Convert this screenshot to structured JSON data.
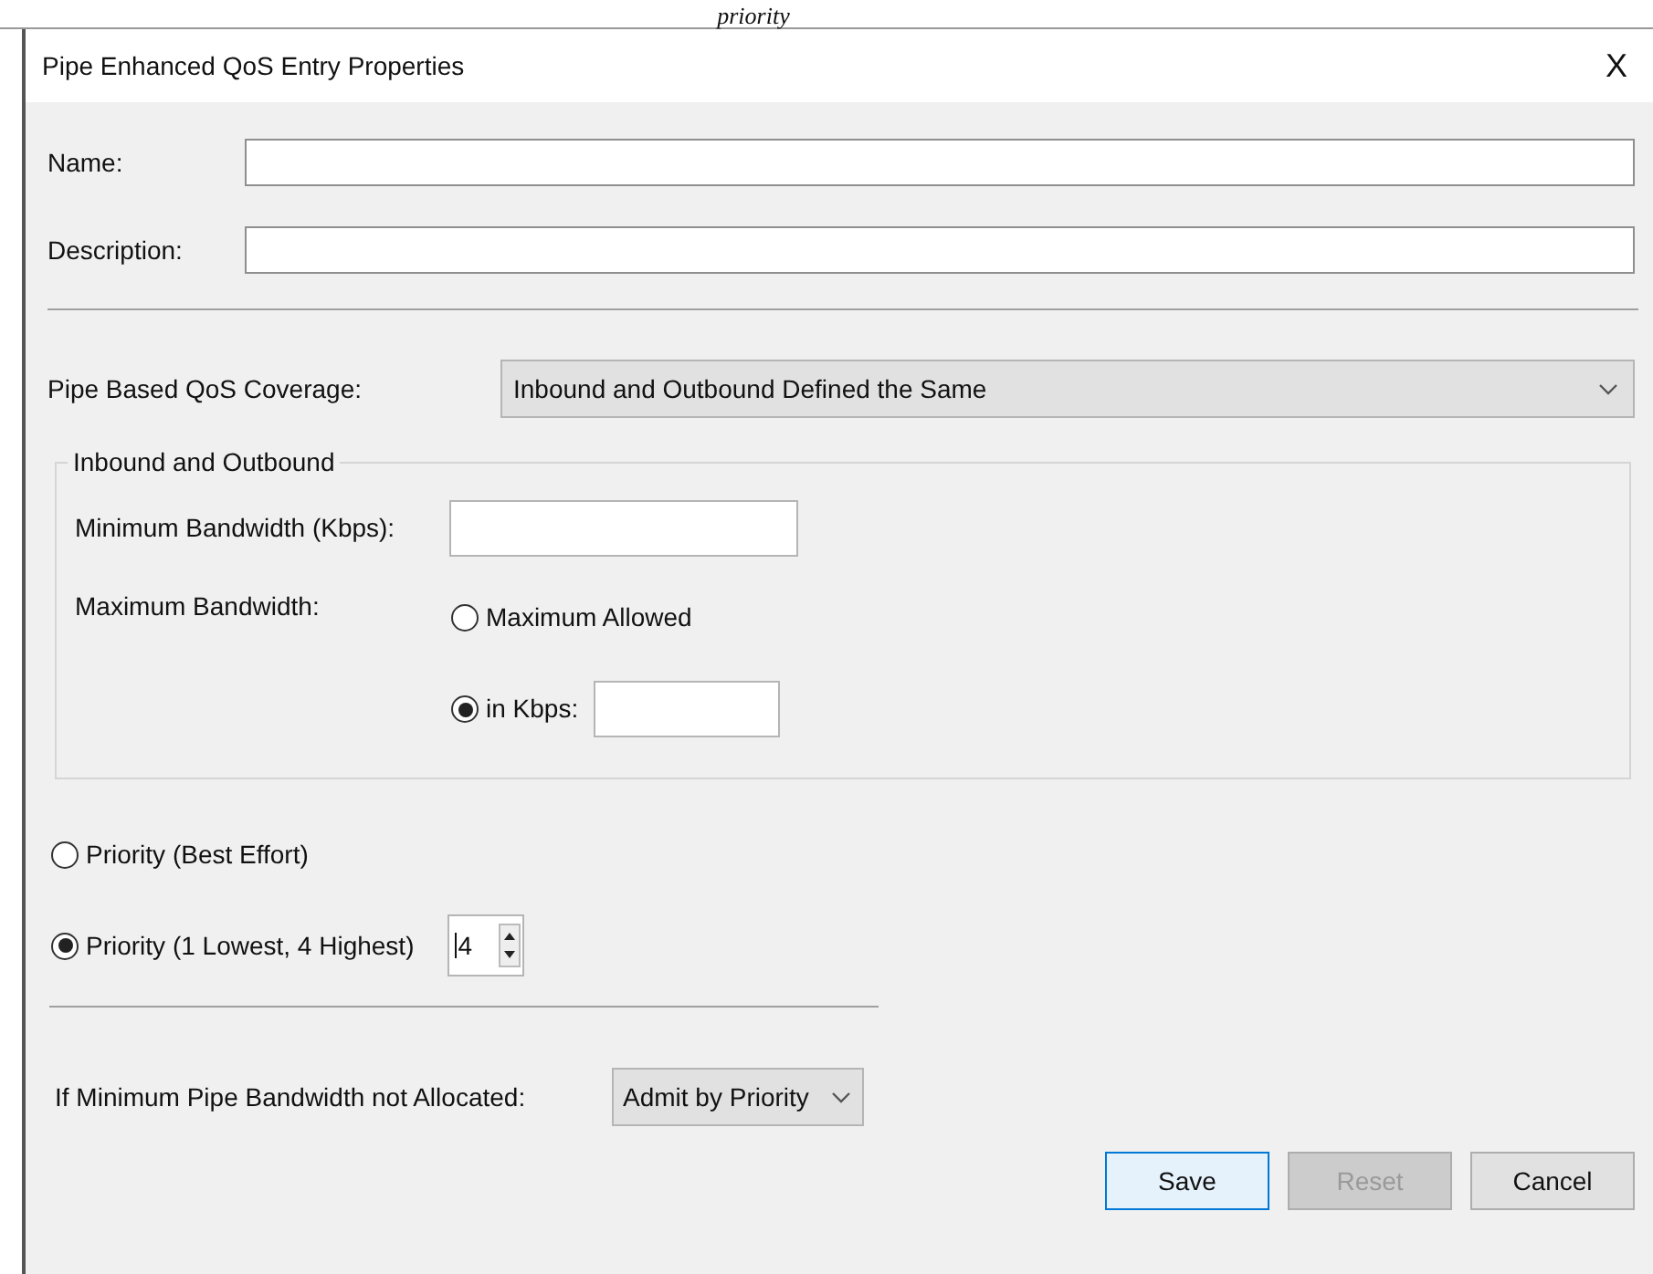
{
  "caption_fragment": "priority",
  "window": {
    "title": "Pipe Enhanced QoS Entry Properties",
    "close": "X"
  },
  "fields": [
    {
      "label": "Name:"
    },
    {
      "label": "Description:"
    }
  ],
  "coverage": {
    "label": "Pipe Based QoS Coverage:",
    "value": "Inbound and Outbound Defined the Same"
  },
  "group": {
    "title": "Inbound and Outbound",
    "min_label": "Minimum Bandwidth (Kbps):",
    "max_label": "Maximum Bandwidth:",
    "max_options": [
      {
        "label": "Maximum Allowed",
        "selected": false,
        "kind": "plain"
      },
      {
        "label": "in Kbps:",
        "selected": true,
        "kind": "input"
      }
    ]
  },
  "priority_options": [
    {
      "label": "Priority (Best Effort)",
      "selected": false,
      "kind": "plain"
    },
    {
      "label": "Priority (1 Lowest, 4 Highest)",
      "selected": true,
      "kind": "spinner"
    }
  ],
  "priority_value": "4",
  "fallback": {
    "label": "If Minimum Pipe Bandwidth not Allocated:",
    "value": "Admit by Priority"
  },
  "buttons": [
    {
      "label": "Save",
      "kind": "default",
      "disabled": false
    },
    {
      "label": "Reset",
      "kind": "normal",
      "disabled": true
    },
    {
      "label": "Cancel",
      "kind": "normal",
      "disabled": false
    }
  ]
}
